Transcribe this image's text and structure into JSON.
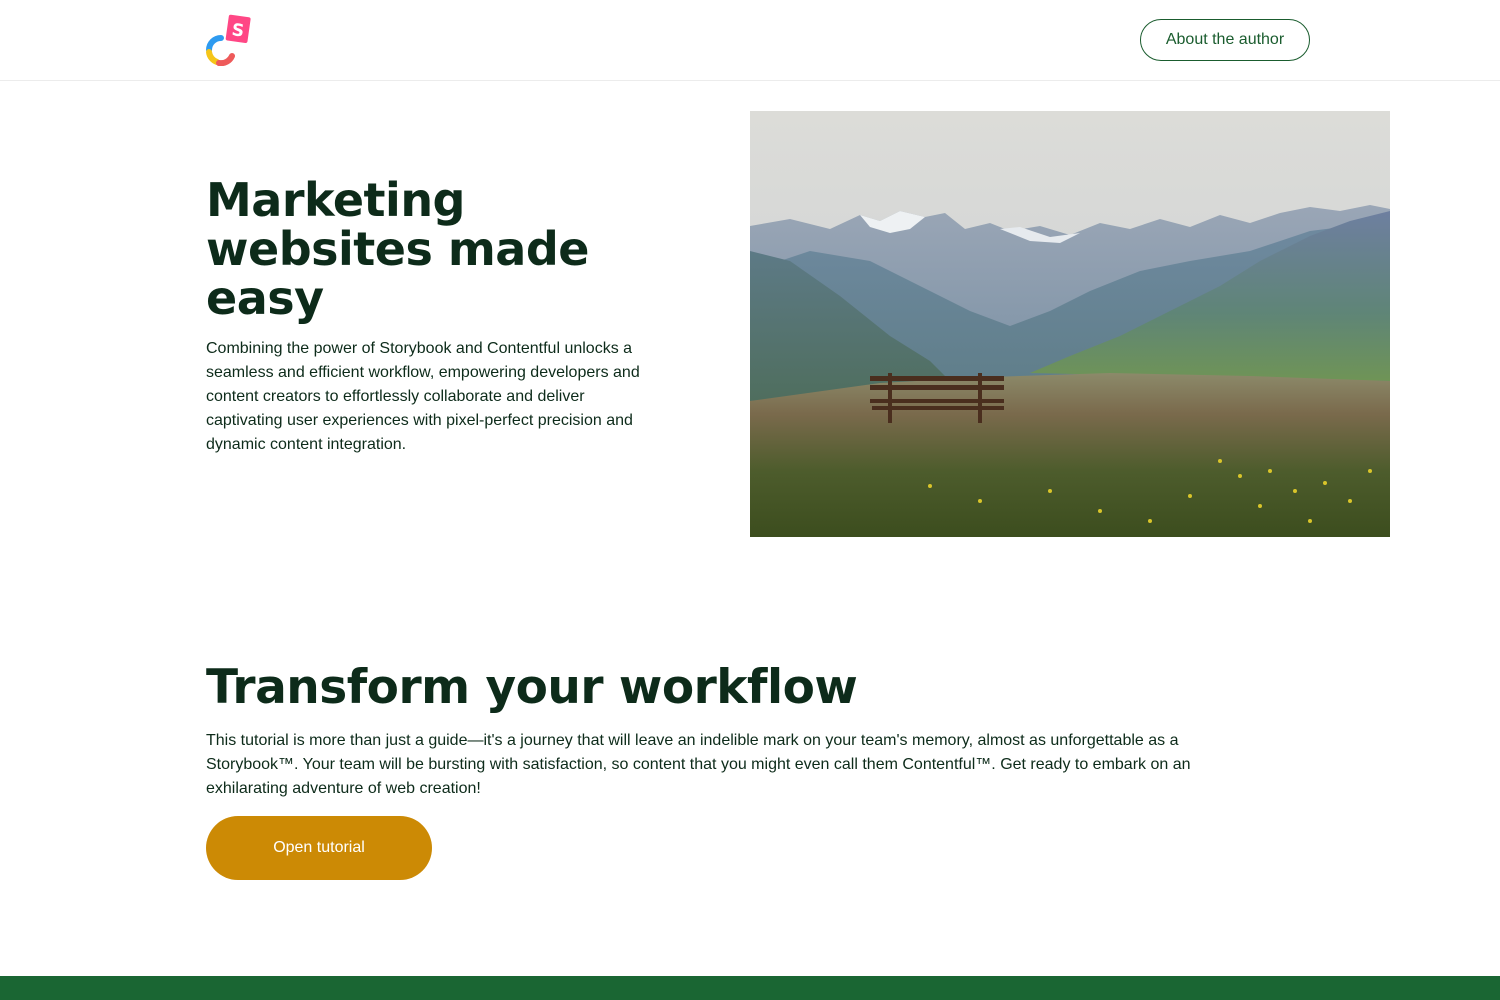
{
  "header": {
    "logo_icon": "storybook-contentful-logo-icon",
    "about_label": "About the author"
  },
  "hero": {
    "title": "Marketing websites made easy",
    "description": "Combining the power of Storybook and Contentful unlocks a seamless and efficient workflow, empowering developers and content creators to effortlessly collaborate and deliver captivating user experiences with pixel-perfect precision and dynamic content integration.",
    "image": "mountain-bench-landscape-image"
  },
  "section": {
    "title": "Transform your workflow",
    "description": "This tutorial is more than just a guide—it's a journey that will leave an indelible mark on your team's memory, almost as unforgettable as a Storybook™. Your team will be bursting with satisfaction, so content that you might even call them Contentful™. Get ready to embark on an exhilarating adventure of web creation!",
    "button_label": "Open tutorial"
  },
  "colors": {
    "heading": "#0d2b1a",
    "accent_green": "#1a5c2e",
    "button_gold": "#cc8a05",
    "footer_green": "#1a6633"
  }
}
